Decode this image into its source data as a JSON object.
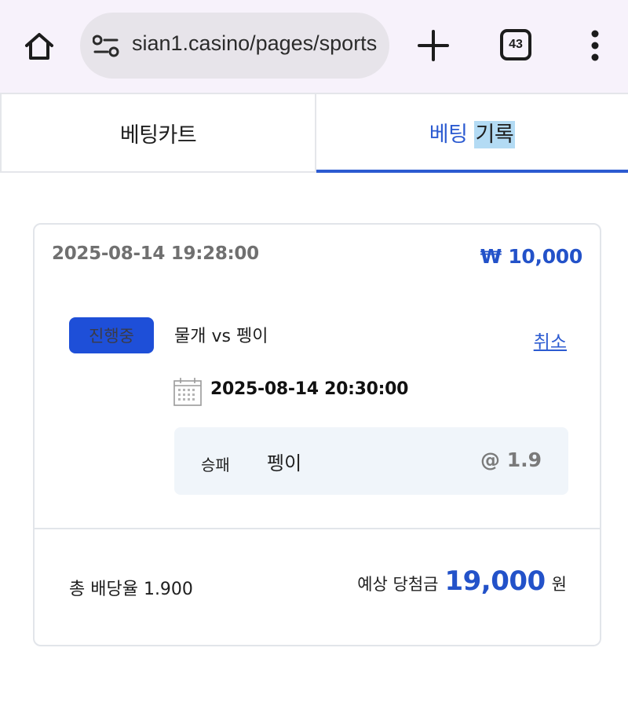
{
  "browser": {
    "url": "sian1.casino/pages/sports",
    "tab_count": "43"
  },
  "tabs": {
    "cart_label": "베팅카트",
    "history_label_a": "베팅 ",
    "history_label_b": "기록"
  },
  "bet": {
    "placed_at": "2025-08-14 19:28:00",
    "amount": "₩ 10,000",
    "status": "진행중",
    "match": "물개 vs 펭이",
    "cancel_label": "취소",
    "match_time": "2025-08-14 20:30:00",
    "market": "승패",
    "selection": "펭이",
    "odds": "@ 1.9",
    "total_odds": "총 배당율 1.900",
    "expected_label": "예상 당첨금",
    "expected_amount": "19,000",
    "expected_unit": "원"
  },
  "colors": {
    "accent": "#2c5bd1",
    "badge_bg": "#1e4fd8",
    "pick_bg": "#f0f5fa",
    "browser_bg": "#f7f2fb"
  },
  "icons": [
    "home-icon",
    "site-info-icon",
    "plus-icon",
    "tabs-icon",
    "more-vert-icon",
    "calendar-icon"
  ]
}
